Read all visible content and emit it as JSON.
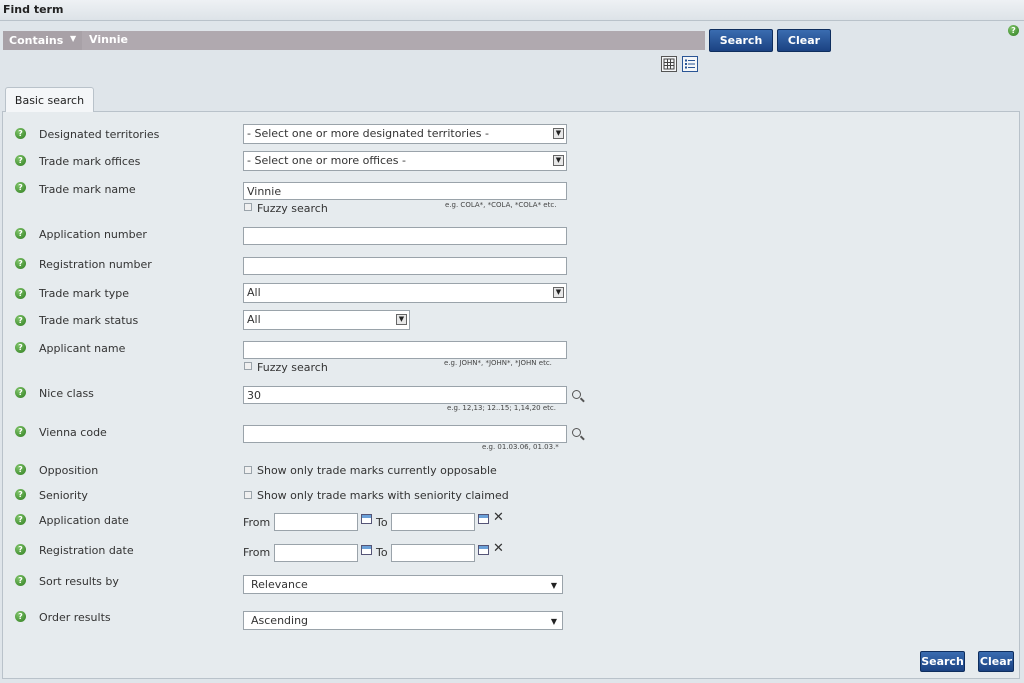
{
  "header": {
    "title": "Find term"
  },
  "quick_search": {
    "mode": "Contains",
    "value": "Vinnie",
    "search_label": "Search",
    "clear_label": "Clear"
  },
  "tabs": [
    {
      "label": "Basic search"
    }
  ],
  "form": {
    "designated_territories": {
      "label": "Designated territories",
      "value": "- Select one or more designated territories -"
    },
    "trade_mark_offices": {
      "label": "Trade mark offices",
      "value": "- Select one or more offices -"
    },
    "trade_mark_name": {
      "label": "Trade mark name",
      "value": "Vinnie",
      "fuzzy_label": "Fuzzy search",
      "hint": "e.g. COLA*, *COLA, *COLA* etc."
    },
    "application_number": {
      "label": "Application number",
      "value": ""
    },
    "registration_number": {
      "label": "Registration number",
      "value": ""
    },
    "trade_mark_type": {
      "label": "Trade mark type",
      "value": "All"
    },
    "trade_mark_status": {
      "label": "Trade mark status",
      "value": "All"
    },
    "applicant_name": {
      "label": "Applicant name",
      "value": "",
      "fuzzy_label": "Fuzzy search",
      "hint": "e.g. JOHN*, *JOHN*, *JOHN etc."
    },
    "nice_class": {
      "label": "Nice class",
      "value": "30",
      "hint": "e.g. 12,13; 12..15; 1,14,20 etc."
    },
    "vienna_code": {
      "label": "Vienna code",
      "value": "",
      "hint": "e.g. 01.03.06, 01.03.*"
    },
    "opposition": {
      "label": "Opposition",
      "checkbox_label": "Show only trade marks currently opposable"
    },
    "seniority": {
      "label": "Seniority",
      "checkbox_label": "Show only trade marks with seniority claimed"
    },
    "application_date": {
      "label": "Application date",
      "from_label": "From",
      "to_label": "To",
      "from": "",
      "to": ""
    },
    "registration_date": {
      "label": "Registration date",
      "from_label": "From",
      "to_label": "To",
      "from": "",
      "to": ""
    },
    "sort_results_by": {
      "label": "Sort results by",
      "value": "Relevance"
    },
    "order_results": {
      "label": "Order results",
      "value": "Ascending"
    }
  },
  "footer": {
    "search_label": "Search",
    "clear_label": "Clear"
  },
  "icons": {
    "help": "question-circle-icon",
    "grid_view": "grid-view-icon",
    "list_view": "list-view-icon",
    "calendar": "calendar-icon",
    "lookup": "magnifier-icon",
    "clear_date": "close-x-icon"
  },
  "colors": {
    "primary_button": "#1b4282",
    "help_icon": "#2f7d1f",
    "quick_search_band": "#b0a9af",
    "background": "#dfe5ea"
  }
}
